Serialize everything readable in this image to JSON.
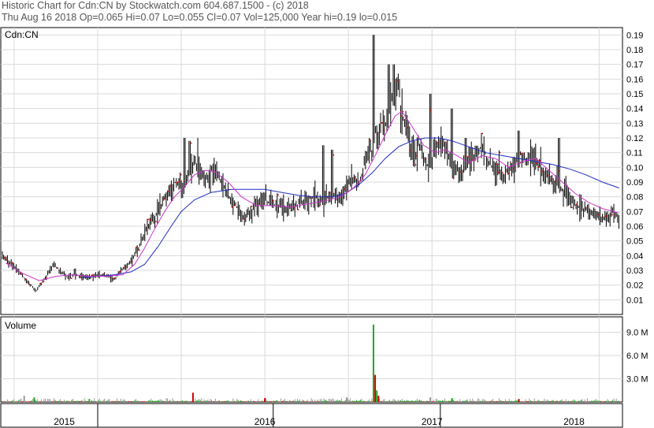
{
  "header": {
    "line1": "Historic Chart for Cdn:CN by Stockwatch.com 604.687.1500 - (c) 2018",
    "line2": "Thu Aug 16 2018   Op=0.065   Hi=0.07   Lo=0.055   Cl=0.07   Vol=125,000   Year hi=0.19   lo=0.015"
  },
  "colors": {
    "background": "#ffffff",
    "grid": "#d9d9d9",
    "price_bar": "#000000",
    "close_tick": "#cc0000",
    "ma_short": "#cc33cc",
    "ma_long": "#1f2bbf",
    "volume_up": "#22aa22",
    "volume_down": "#cc0000",
    "volume_flat": "#999999"
  },
  "chart_data": [
    {
      "type": "line",
      "subtype": "ohlc-price",
      "title": "Cdn:CN",
      "ylim": [
        0,
        0.195
      ],
      "yticks": [
        "0.01",
        "0.02",
        "0.03",
        "0.04",
        "0.05",
        "0.06",
        "0.07",
        "0.08",
        "0.09",
        "0.10",
        "0.11",
        "0.12",
        "0.13",
        "0.14",
        "0.15",
        "0.16",
        "0.17",
        "0.18",
        "0.19"
      ],
      "xticks": [
        "2015",
        "2016",
        "2017",
        "2018"
      ],
      "grid": true,
      "price_path": [
        [
          2014.93,
          0.04
        ],
        [
          2014.98,
          0.035
        ],
        [
          2015.02,
          0.03
        ],
        [
          2015.06,
          0.025
        ],
        [
          2015.1,
          0.02
        ],
        [
          2015.13,
          0.016
        ],
        [
          2015.17,
          0.022
        ],
        [
          2015.2,
          0.028
        ],
        [
          2015.24,
          0.034
        ],
        [
          2015.27,
          0.03
        ],
        [
          2015.32,
          0.025
        ],
        [
          2015.36,
          0.028
        ],
        [
          2015.4,
          0.026
        ],
        [
          2015.45,
          0.025
        ],
        [
          2015.5,
          0.027
        ],
        [
          2015.55,
          0.026
        ],
        [
          2015.6,
          0.024
        ],
        [
          2015.64,
          0.03
        ],
        [
          2015.68,
          0.034
        ],
        [
          2015.72,
          0.04
        ],
        [
          2015.75,
          0.047
        ],
        [
          2015.78,
          0.055
        ],
        [
          2015.81,
          0.06
        ],
        [
          2015.84,
          0.066
        ],
        [
          2015.87,
          0.072
        ],
        [
          2015.9,
          0.08
        ],
        [
          2015.93,
          0.085
        ],
        [
          2015.96,
          0.09
        ],
        [
          2016.0,
          0.085
        ],
        [
          2016.03,
          0.092
        ],
        [
          2016.05,
          0.098
        ],
        [
          2016.08,
          0.105
        ],
        [
          2016.1,
          0.1
        ],
        [
          2016.13,
          0.095
        ],
        [
          2016.16,
          0.092
        ],
        [
          2016.19,
          0.1
        ],
        [
          2016.22,
          0.095
        ],
        [
          2016.26,
          0.085
        ],
        [
          2016.3,
          0.078
        ],
        [
          2016.34,
          0.072
        ],
        [
          2016.38,
          0.066
        ],
        [
          2016.42,
          0.07
        ],
        [
          2016.46,
          0.075
        ],
        [
          2016.5,
          0.078
        ],
        [
          2016.55,
          0.075
        ],
        [
          2016.6,
          0.073
        ],
        [
          2016.65,
          0.072
        ],
        [
          2016.7,
          0.075
        ],
        [
          2016.75,
          0.078
        ],
        [
          2016.8,
          0.08
        ],
        [
          2016.85,
          0.076
        ],
        [
          2016.88,
          0.08
        ],
        [
          2016.92,
          0.083
        ],
        [
          2016.95,
          0.08
        ],
        [
          2016.98,
          0.085
        ],
        [
          2017.01,
          0.09
        ],
        [
          2017.04,
          0.092
        ],
        [
          2017.07,
          0.09
        ],
        [
          2017.1,
          0.105
        ],
        [
          2017.12,
          0.112
        ],
        [
          2017.14,
          0.11
        ],
        [
          2017.16,
          0.125
        ],
        [
          2017.18,
          0.12
        ],
        [
          2017.2,
          0.13
        ],
        [
          2017.22,
          0.128
        ],
        [
          2017.24,
          0.14
        ],
        [
          2017.26,
          0.145
        ],
        [
          2017.28,
          0.15
        ],
        [
          2017.3,
          0.155
        ],
        [
          2017.32,
          0.135
        ],
        [
          2017.34,
          0.128
        ],
        [
          2017.36,
          0.12
        ],
        [
          2017.38,
          0.112
        ],
        [
          2017.4,
          0.108
        ],
        [
          2017.42,
          0.115
        ],
        [
          2017.44,
          0.11
        ],
        [
          2017.46,
          0.105
        ],
        [
          2017.48,
          0.1
        ],
        [
          2017.5,
          0.105
        ],
        [
          2017.52,
          0.11
        ],
        [
          2017.55,
          0.12
        ],
        [
          2017.58,
          0.112
        ],
        [
          2017.61,
          0.105
        ],
        [
          2017.64,
          0.1
        ],
        [
          2017.67,
          0.095
        ],
        [
          2017.7,
          0.1
        ],
        [
          2017.73,
          0.105
        ],
        [
          2017.76,
          0.11
        ],
        [
          2017.8,
          0.115
        ],
        [
          2017.83,
          0.105
        ],
        [
          2017.86,
          0.1
        ],
        [
          2017.9,
          0.098
        ],
        [
          2017.93,
          0.095
        ],
        [
          2017.96,
          0.1
        ],
        [
          2018.0,
          0.102
        ],
        [
          2018.03,
          0.11
        ],
        [
          2018.06,
          0.105
        ],
        [
          2018.09,
          0.108
        ],
        [
          2018.12,
          0.105
        ],
        [
          2018.15,
          0.1
        ],
        [
          2018.18,
          0.095
        ],
        [
          2018.21,
          0.092
        ],
        [
          2018.24,
          0.09
        ],
        [
          2018.28,
          0.085
        ],
        [
          2018.32,
          0.08
        ],
        [
          2018.36,
          0.075
        ],
        [
          2018.4,
          0.072
        ],
        [
          2018.44,
          0.07
        ],
        [
          2018.48,
          0.068
        ],
        [
          2018.52,
          0.065
        ],
        [
          2018.56,
          0.068
        ],
        [
          2018.59,
          0.07
        ],
        [
          2018.62,
          0.065
        ]
      ],
      "spikes": [
        [
          2016.02,
          0.12
        ],
        [
          2016.05,
          0.118
        ],
        [
          2016.1,
          0.12
        ],
        [
          2016.85,
          0.115
        ],
        [
          2016.9,
          0.112
        ],
        [
          2017.15,
          0.19
        ],
        [
          2017.24,
          0.17
        ],
        [
          2017.27,
          0.17
        ],
        [
          2017.49,
          0.15
        ],
        [
          2017.62,
          0.14
        ],
        [
          2017.7,
          0.12
        ],
        [
          2018.02,
          0.125
        ],
        [
          2018.26,
          0.12
        ]
      ],
      "x_range": [
        2014.92,
        2018.64
      ],
      "ma_short": [
        [
          2014.95,
          0.035
        ],
        [
          2015.05,
          0.028
        ],
        [
          2015.15,
          0.023
        ],
        [
          2015.25,
          0.026
        ],
        [
          2015.35,
          0.027
        ],
        [
          2015.45,
          0.026
        ],
        [
          2015.55,
          0.026
        ],
        [
          2015.65,
          0.027
        ],
        [
          2015.72,
          0.034
        ],
        [
          2015.78,
          0.045
        ],
        [
          2015.84,
          0.058
        ],
        [
          2015.9,
          0.07
        ],
        [
          2015.96,
          0.08
        ],
        [
          2016.02,
          0.087
        ],
        [
          2016.08,
          0.095
        ],
        [
          2016.14,
          0.098
        ],
        [
          2016.2,
          0.097
        ],
        [
          2016.28,
          0.09
        ],
        [
          2016.36,
          0.08
        ],
        [
          2016.45,
          0.074
        ],
        [
          2016.55,
          0.074
        ],
        [
          2016.65,
          0.073
        ],
        [
          2016.75,
          0.075
        ],
        [
          2016.85,
          0.077
        ],
        [
          2016.95,
          0.08
        ],
        [
          2017.03,
          0.086
        ],
        [
          2017.1,
          0.095
        ],
        [
          2017.16,
          0.108
        ],
        [
          2017.22,
          0.122
        ],
        [
          2017.28,
          0.135
        ],
        [
          2017.32,
          0.138
        ],
        [
          2017.38,
          0.128
        ],
        [
          2017.45,
          0.115
        ],
        [
          2017.52,
          0.11
        ],
        [
          2017.58,
          0.112
        ],
        [
          2017.65,
          0.108
        ],
        [
          2017.72,
          0.103
        ],
        [
          2017.8,
          0.108
        ],
        [
          2017.88,
          0.106
        ],
        [
          2017.96,
          0.1
        ],
        [
          2018.04,
          0.104
        ],
        [
          2018.12,
          0.106
        ],
        [
          2018.2,
          0.098
        ],
        [
          2018.28,
          0.09
        ],
        [
          2018.36,
          0.082
        ],
        [
          2018.44,
          0.076
        ],
        [
          2018.52,
          0.072
        ],
        [
          2018.62,
          0.069
        ]
      ],
      "ma_long": [
        [
          2015.4,
          0.025
        ],
        [
          2015.5,
          0.026
        ],
        [
          2015.6,
          0.027
        ],
        [
          2015.7,
          0.029
        ],
        [
          2015.78,
          0.034
        ],
        [
          2015.86,
          0.046
        ],
        [
          2015.94,
          0.06
        ],
        [
          2016.0,
          0.07
        ],
        [
          2016.08,
          0.078
        ],
        [
          2016.18,
          0.083
        ],
        [
          2016.3,
          0.085
        ],
        [
          2016.4,
          0.085
        ],
        [
          2016.5,
          0.085
        ],
        [
          2016.6,
          0.083
        ],
        [
          2016.7,
          0.081
        ],
        [
          2016.8,
          0.08
        ],
        [
          2016.9,
          0.08
        ],
        [
          2016.98,
          0.082
        ],
        [
          2017.06,
          0.088
        ],
        [
          2017.14,
          0.096
        ],
        [
          2017.22,
          0.106
        ],
        [
          2017.3,
          0.114
        ],
        [
          2017.38,
          0.118
        ],
        [
          2017.46,
          0.12
        ],
        [
          2017.54,
          0.12
        ],
        [
          2017.62,
          0.118
        ],
        [
          2017.72,
          0.114
        ],
        [
          2017.82,
          0.11
        ],
        [
          2017.92,
          0.108
        ],
        [
          2018.02,
          0.106
        ],
        [
          2018.12,
          0.104
        ],
        [
          2018.22,
          0.102
        ],
        [
          2018.32,
          0.099
        ],
        [
          2018.42,
          0.095
        ],
        [
          2018.52,
          0.09
        ],
        [
          2018.62,
          0.086
        ]
      ]
    },
    {
      "type": "bar",
      "subtype": "volume",
      "title": "Volume",
      "ylim": [
        0,
        11.0
      ],
      "yticks": [
        "3.0 M",
        "6.0 M",
        "9.0 M"
      ],
      "peaks": [
        [
          2015.06,
          0.8,
          "flat"
        ],
        [
          2015.12,
          0.6,
          "up"
        ],
        [
          2015.45,
          0.4,
          "up"
        ],
        [
          2016.07,
          1.2,
          "down"
        ],
        [
          2016.5,
          0.5,
          "down"
        ],
        [
          2016.99,
          0.6,
          "flat"
        ],
        [
          2017.15,
          10.0,
          "up"
        ],
        [
          2017.16,
          3.5,
          "down"
        ],
        [
          2017.17,
          1.5,
          "up"
        ],
        [
          2017.18,
          0.8,
          "down"
        ],
        [
          2017.49,
          0.6,
          "flat"
        ],
        [
          2017.62,
          0.5,
          "up"
        ],
        [
          2018.02,
          0.4,
          "down"
        ]
      ]
    }
  ]
}
